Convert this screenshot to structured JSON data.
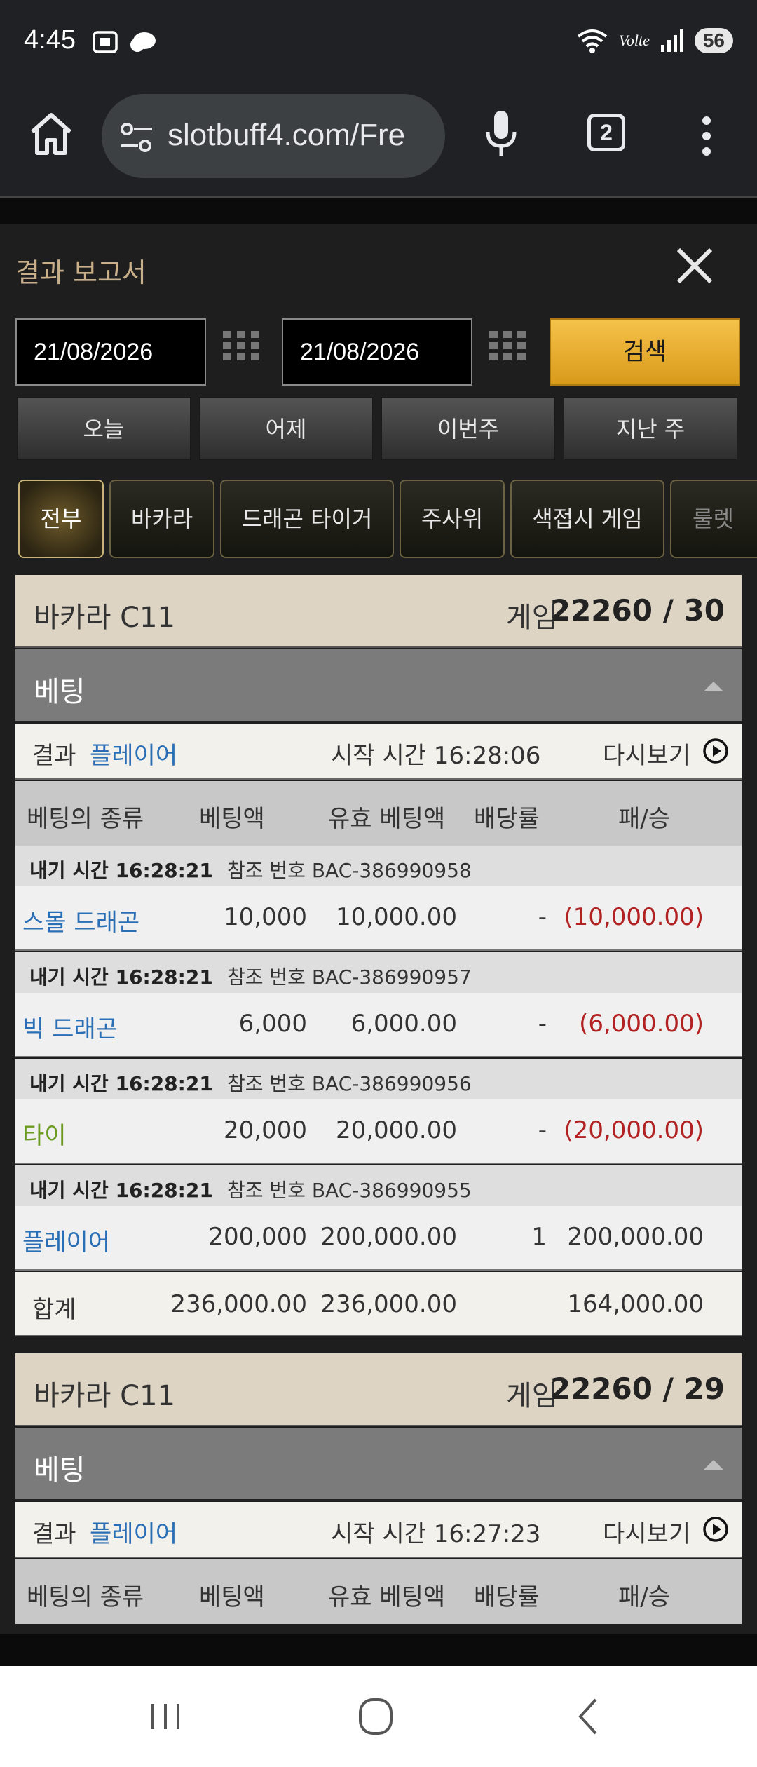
{
  "status": {
    "time": "4:45",
    "battery": "56",
    "network": "Volte"
  },
  "browser": {
    "url": "slotbuff4.com/Fre",
    "tab_count": "2"
  },
  "modal": {
    "title": "결과 보고서",
    "date_from": "21/08/2026",
    "date_to": "21/08/2026",
    "search_label": "검색",
    "quick_ranges": [
      "오늘",
      "어제",
      "이번주",
      "지난 주"
    ],
    "filters": [
      "전부",
      "바카라",
      "드래곤 타이거",
      "주사위",
      "색접시 게임",
      "룰렛"
    ],
    "active_filter": "전부"
  },
  "cards": [
    {
      "name": "바카라 C11",
      "game_label": "게임",
      "game_value": "22260 / 30",
      "bet_label": "베팅",
      "result_label": "결과",
      "result_value": "플레이어",
      "start_time": "시작 시간 16:28:06",
      "replay": "다시보기",
      "columns": [
        "베팅의 종류",
        "베팅액",
        "유효 베팅액",
        "배당률",
        "패/승"
      ],
      "bets": [
        {
          "time": "내기 시간 16:28:21",
          "ref": "참조 번호 BAC-386990958",
          "type": "스몰 드래곤",
          "type_color": "#2a6fb5",
          "amount": "10,000",
          "valid": "10,000.00",
          "odds": "-",
          "pl": "(10,000.00)"
        },
        {
          "time": "내기 시간 16:28:21",
          "ref": "참조 번호 BAC-386990957",
          "type": "빅 드래곤",
          "type_color": "#2a6fb5",
          "amount": "6,000",
          "valid": "6,000.00",
          "odds": "-",
          "pl": "(6,000.00)"
        },
        {
          "time": "내기 시간 16:28:21",
          "ref": "참조 번호 BAC-386990956",
          "type": "타이",
          "type_color": "#6a9a1f",
          "amount": "20,000",
          "valid": "20,000.00",
          "odds": "-",
          "pl": "(20,000.00)"
        },
        {
          "time": "내기 시간 16:28:21",
          "ref": "참조 번호 BAC-386990955",
          "type": "플레이어",
          "type_color": "#2a6fb5",
          "amount": "200,000",
          "valid": "200,000.00",
          "odds": "1",
          "pl": "200,000.00"
        }
      ],
      "total": {
        "label": "합계",
        "amount": "236,000.00",
        "valid": "236,000.00",
        "pl": "164,000.00"
      }
    },
    {
      "name": "바카라 C11",
      "game_label": "게임",
      "game_value": "22260 / 29",
      "bet_label": "베팅",
      "result_label": "결과",
      "result_value": "플레이어",
      "start_time": "시작 시간 16:27:23",
      "replay": "다시보기",
      "columns": [
        "베팅의 종류",
        "베팅액",
        "유효 베팅액",
        "배당률",
        "패/승"
      ]
    }
  ]
}
